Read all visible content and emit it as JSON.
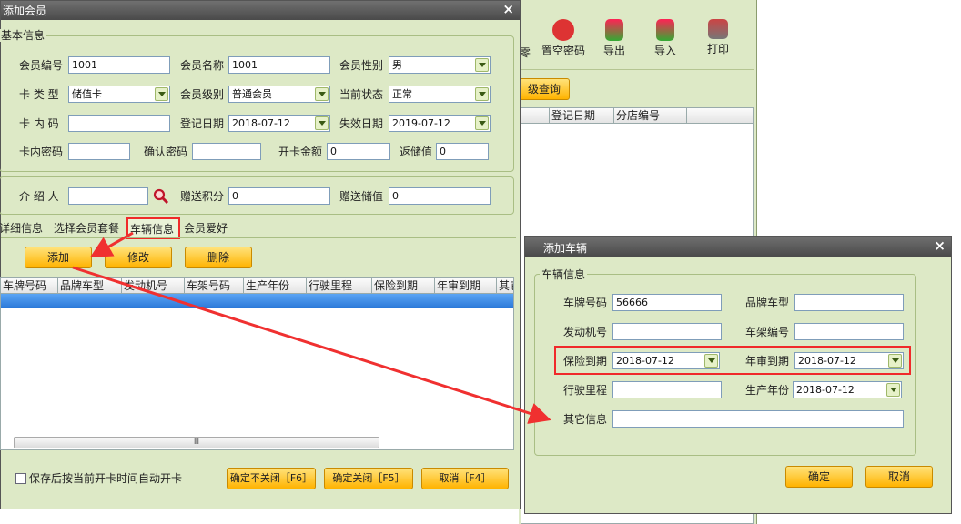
{
  "main_window": {
    "title": "添加会员",
    "close_glyph": "×",
    "basic_info": {
      "title": "基本信息",
      "member_no_label": "会员编号",
      "member_no": "1001",
      "member_name_label": "会员名称",
      "member_name": "1001",
      "gender_label": "会员性别",
      "gender": "男",
      "card_type_label": "卡 类 型",
      "card_type": "储值卡",
      "level_label": "会员级别",
      "level": "普通会员",
      "status_label": "当前状态",
      "status": "正常",
      "inner_code_label": "卡 内 码",
      "inner_code": "",
      "reg_date_label": "登记日期",
      "reg_date": "2018-07-12",
      "expire_label": "失效日期",
      "expire_date": "2019-07-12",
      "card_pwd_label": "卡内密码",
      "card_pwd": "",
      "confirm_pwd_label": "确认密码",
      "confirm_pwd": "",
      "open_amount_label": "开卡金额",
      "open_amount": "0",
      "return_value_label": "返储值",
      "return_value": "0"
    },
    "referral": {
      "referrer_label": "介 绍 人",
      "referrer": "",
      "gift_points_label": "赠送积分",
      "gift_points": "0",
      "gift_value_label": "赠送储值",
      "gift_value": "0"
    },
    "tabs": [
      "详细信息",
      "选择会员套餐",
      "车辆信息",
      "会员爱好"
    ],
    "actions": {
      "add": "添加",
      "edit": "修改",
      "delete": "删除"
    },
    "table": {
      "columns": [
        "车牌号码",
        "品牌车型",
        "发动机号",
        "车架号码",
        "生产年份",
        "行驶里程",
        "保险到期",
        "年审到期",
        "其它"
      ],
      "scroll_glyph": "Ⅲ"
    },
    "footer": {
      "auto_open_label": "保存后按当前开卡时间自动开卡",
      "confirm_no_close": "确定不关闭［F6］",
      "confirm_close": "确定关闭［F5］",
      "cancel": "取消［F4］"
    }
  },
  "background": {
    "toolbar": [
      {
        "label": "零",
        "icon": "partial-icon"
      },
      {
        "label": "置空密码",
        "icon": "reset-password-icon"
      },
      {
        "label": "导出",
        "icon": "export-icon"
      },
      {
        "label": "导入",
        "icon": "import-icon"
      },
      {
        "label": "打印",
        "icon": "print-icon"
      }
    ],
    "query_button": "级查询",
    "columns": [
      "登记日期",
      "分店编号"
    ]
  },
  "car_dialog": {
    "title": "添加车辆",
    "close_glyph": "×",
    "group_title": "车辆信息",
    "plate_label": "车牌号码",
    "plate": "56666",
    "brand_label": "品牌车型",
    "brand": "",
    "engine_label": "发动机号",
    "engine": "",
    "frame_label": "车架编号",
    "frame": "",
    "insurance_label": "保险到期",
    "insurance_date": "2018-07-12",
    "inspection_label": "年审到期",
    "inspection_date": "2018-07-12",
    "mileage_label": "行驶里程",
    "mileage": "",
    "year_label": "生产年份",
    "year": "2018-07-12",
    "other_label": "其它信息",
    "other": "",
    "ok": "确定",
    "cancel": "取消"
  },
  "colors": {
    "accent": "#ff0000",
    "title_bar": "#5a5a5a",
    "panel": "#dde9c6",
    "button": "#ffc200",
    "selected_row": "#3d8ee8"
  }
}
